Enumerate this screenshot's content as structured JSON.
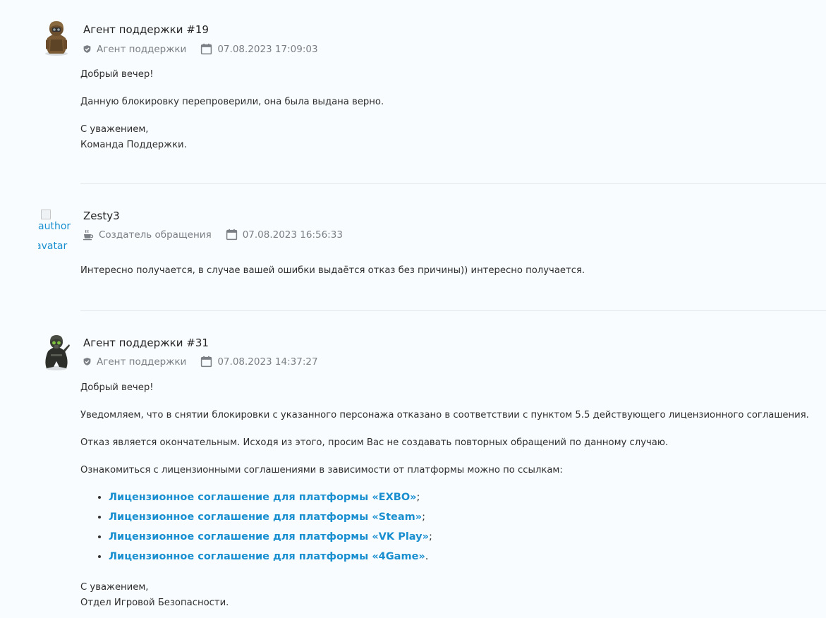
{
  "messages": [
    {
      "author": "Агент поддержки #19",
      "role": "Агент поддержки",
      "role_icon": "shield-icon",
      "date": "07.08.2023 17:09:03",
      "date_icon": "calendar-icon",
      "paragraphs": [
        "Добрый вечер!",
        "Данную блокировку перепроверили, она была выдана верно.",
        "С уважением,",
        "Команда Поддержки."
      ]
    },
    {
      "author": "Zesty3",
      "role": "Создатель обращения",
      "role_icon": "coffee-cup-icon",
      "date": "07.08.2023 16:56:33",
      "date_icon": "calendar-icon",
      "avatar_alt_line1": "author",
      "avatar_alt_line2": "avatar",
      "paragraphs": [
        "Интересно получается, в случае вашей ошибки выдаётся отказ без причины)) интересно получается."
      ]
    },
    {
      "author": "Агент поддержки #31",
      "role": "Агент поддержки",
      "role_icon": "shield-icon",
      "date": "07.08.2023 14:37:27",
      "date_icon": "calendar-icon",
      "paragraphs": [
        "Добрый вечер!",
        "Уведомляем, что в снятии блокировки с указанного персонажа отказано в соответствии с пунктом 5.5 действующего лицензионного соглашения.",
        "Отказ является окончательным. Исходя из этого, просим Вас не создавать повторных обращений по данному случаю.",
        "Ознакомиться с лицензионными соглашениями в зависимости от платформы можно по ссылкам:"
      ],
      "links": [
        {
          "text": "Лицензионное соглашение для платформы «EXBO»",
          "suffix": ";"
        },
        {
          "text": "Лицензионное соглашение для платформы «Steam»",
          "suffix": ";"
        },
        {
          "text": "Лицензионное соглашение для платформы «VK Play»",
          "suffix": ";"
        },
        {
          "text": "Лицензионное соглашение для платформы «4Game»",
          "suffix": "."
        }
      ],
      "signature": [
        "С уважением,",
        "Отдел Игровой Безопасности."
      ]
    }
  ],
  "colors": {
    "background": "#f8fcfe",
    "link": "#1a8fd0",
    "meta": "#7a7f85",
    "divider": "#e3e8ec"
  }
}
